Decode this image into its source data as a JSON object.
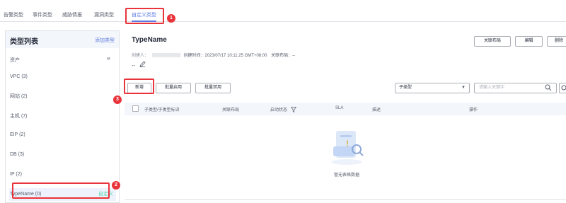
{
  "tabs": [
    {
      "label": "告警类型",
      "active": false
    },
    {
      "label": "事件类型",
      "active": false
    },
    {
      "label": "威胁情报",
      "active": false
    },
    {
      "label": "漏洞类型",
      "active": false
    },
    {
      "label": "自定义类型",
      "active": true
    }
  ],
  "callouts": {
    "tab": "1",
    "type_item": "2",
    "new_button": "3"
  },
  "sidebar": {
    "title": "类型列表",
    "add_label": "添加类型",
    "group_label": "资产",
    "group_chevron": "«",
    "items": [
      {
        "label": "VPC (3)"
      },
      {
        "label": "网站 (2)"
      },
      {
        "label": "主机 (7)"
      },
      {
        "label": "EIP (2)"
      },
      {
        "label": "DB (3)"
      },
      {
        "label": "IP (2)"
      },
      {
        "label": "TypeName (0)",
        "tag": "自定义",
        "selected": true
      }
    ]
  },
  "detail": {
    "title": "TypeName",
    "creator_label": "创建人：",
    "created_time": "创建时间：2023/07/17 10:11:25 GMT+08:00",
    "layout_label": "关联布局：--",
    "description": "--"
  },
  "header_buttons": {
    "layout": "关联布局",
    "edit": "编辑",
    "delete": "删除"
  },
  "toolbar": {
    "new_label": "新增",
    "batch_enable": "批量启用",
    "batch_disable": "批量禁用",
    "filter_select": "子类型",
    "search_placeholder": "请输入关键字"
  },
  "table": {
    "columns": [
      "子类型/子类型标识",
      "关联布局",
      "启动状态",
      "SLA",
      "描述",
      "操作"
    ],
    "empty_text": "暂无表格数据"
  },
  "colors": {
    "accent": "#5e7ce0",
    "highlight": "#e8343a",
    "custom_tag": "#50d4ab"
  }
}
